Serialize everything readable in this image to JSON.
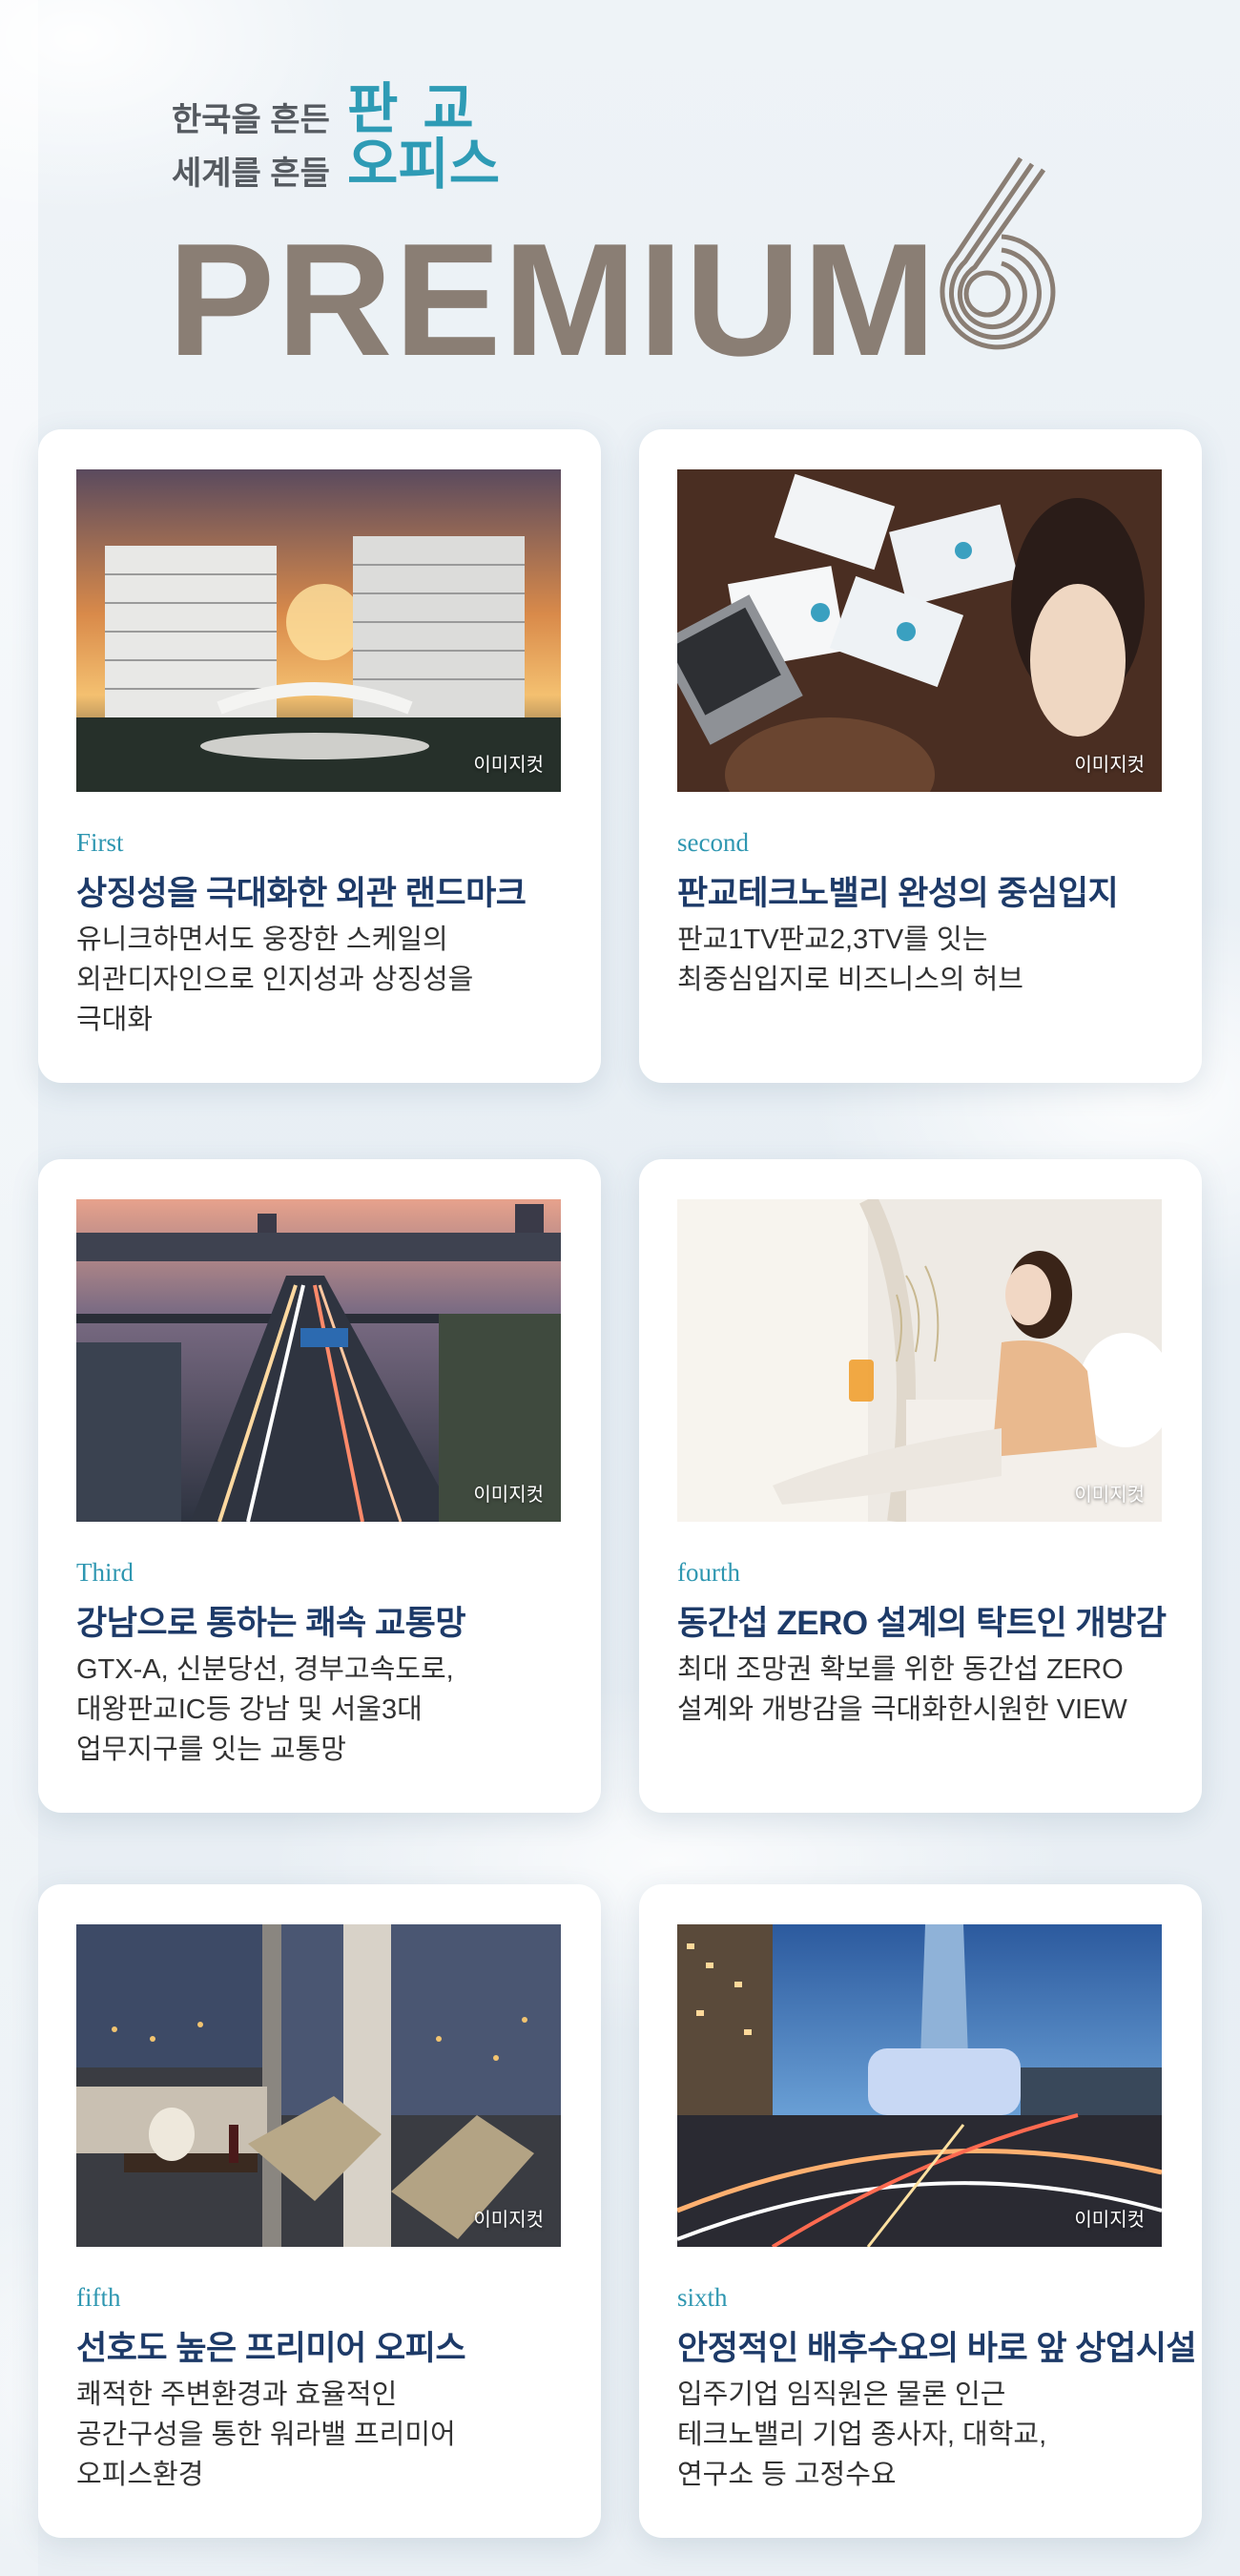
{
  "header": {
    "tagline_line1": "한국을 흔든",
    "tagline_line2": "세계를 흔들",
    "accent_line1": "판교",
    "accent_line2": "오피스",
    "title": "PREMIUM",
    "number": "6",
    "colors": {
      "accent": "#2e9bb5",
      "title": "#8a7e74",
      "heading": "#1d3a68"
    }
  },
  "photo_caption": "이미지컷",
  "cards": [
    {
      "ordinal": "First",
      "heading": "상징성을 극대화한 외관 랜드마크",
      "desc_lines": [
        "유니크하면서도 웅장한 스케일의",
        "외관디자인으로 인지성과 상징성을",
        "극대화"
      ],
      "photo": "building-sunset-photo"
    },
    {
      "ordinal": "second",
      "heading": "판교테크노밸리 완성의 중심입지",
      "desc_lines": [
        "판교1TV판교2,3TV를 잇는",
        "최중심입지로 비즈니스의 허브"
      ],
      "photo": "business-meeting-photo"
    },
    {
      "ordinal": "Third",
      "heading": "강남으로 통하는 쾌속 교통망",
      "desc_lines": [
        "GTX-A, 신분당선, 경부고속도로,",
        "대왕판교IC등 강남 및 서울3대",
        "업무지구를 잇는 교통망"
      ],
      "photo": "highway-photo"
    },
    {
      "ordinal": "fourth",
      "heading": "동간섭 ZERO 설계의 탁트인 개방감",
      "desc_lines": [
        "최대 조망권 확보를 위한 동간섭 ZERO",
        "설계와 개방감을 극대화한시원한 VIEW"
      ],
      "photo": "woman-on-sofa-photo"
    },
    {
      "ordinal": "fifth",
      "heading": "선호도 높은 프리미어 오피스",
      "desc_lines": [
        "쾌적한 주변환경과 효율적인",
        "공간구성을 통한 워라밸 프리미어",
        "오피스환경"
      ],
      "photo": "lounge-interior-photo"
    },
    {
      "ordinal": "sixth",
      "heading": "안정적인 배후수요의 바로 앞 상업시설",
      "desc_lines": [
        "입주기업 임직원은 물론 인근",
        "테크노밸리 기업 종사자, 대학교,",
        "연구소 등 고정수요"
      ],
      "photo": "city-intersection-photo"
    }
  ]
}
